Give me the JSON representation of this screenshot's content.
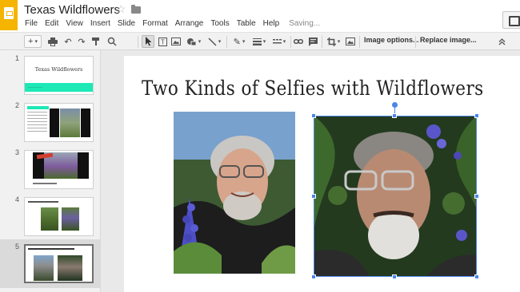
{
  "app": {
    "doc_title": "Texas Wildflowers",
    "menu": [
      "File",
      "Edit",
      "View",
      "Insert",
      "Slide",
      "Format",
      "Arrange",
      "Tools",
      "Table",
      "Help"
    ],
    "saving_status": "Saving..."
  },
  "toolbar": {
    "image_options_label": "Image options...",
    "replace_image_label": "Replace image..."
  },
  "filmstrip": {
    "slides": [
      {
        "number": "1",
        "title": "Texas Wildflowers"
      },
      {
        "number": "2"
      },
      {
        "number": "3"
      },
      {
        "number": "4"
      },
      {
        "number": "5",
        "selected": true
      }
    ]
  },
  "slide": {
    "title": "Two Kinds of Selfies with Wildflowers"
  },
  "colors": {
    "logo": "#f4b400",
    "selection": "#4a86e8",
    "thumb_accent": "#1de9b6"
  }
}
